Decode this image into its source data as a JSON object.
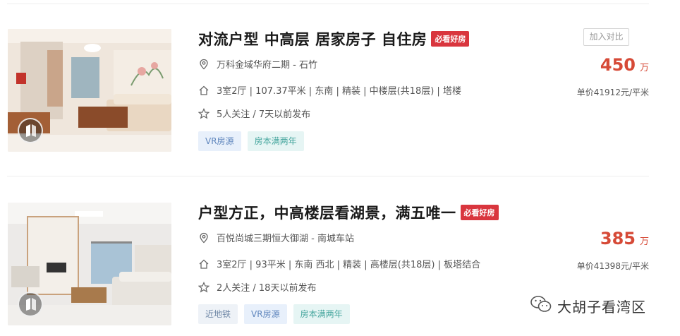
{
  "listings": [
    {
      "title": "对流户型 中高层 居家房子 自住房",
      "badge": "必看好房",
      "community": "万科金域华府二期 - 石竹",
      "details": "3室2厅 | 107.37平米 | 东南 | 精装 | 中楼层(共18层) | 塔楼",
      "followers": "5人关注 / 7天以前发布",
      "tags": [
        "VR房源",
        "房本满两年"
      ],
      "compare_label": "加入对比",
      "price": "450",
      "price_unit": "万",
      "unit_price": "单价41912元/平米"
    },
    {
      "title": "户型方正，中高楼层看湖景，满五唯一",
      "badge": "必看好房",
      "community": "百悦尚城三期恒大御湖 - 南城车站",
      "details": "3室2厅 | 93平米 | 东南 西北 | 精装 | 高楼层(共18层) | 板塔结合",
      "followers": "2人关注 / 18天以前发布",
      "tags": [
        "近地铁",
        "VR房源",
        "房本满两年"
      ],
      "price": "385",
      "price_unit": "万",
      "unit_price": "单价41398元/平米"
    }
  ],
  "watermark": "大胡子看湾区",
  "icons": {
    "location": "location-pin-icon",
    "house": "house-icon",
    "star": "star-outline-icon",
    "vr": "vr-360-icon",
    "wechat": "wechat-logo-icon"
  },
  "colors": {
    "price": "#d64a37",
    "badge": "#d9363e",
    "tag_vr_bg": "#e8f0fb",
    "tag_cert_bg": "#e6f5f4"
  }
}
